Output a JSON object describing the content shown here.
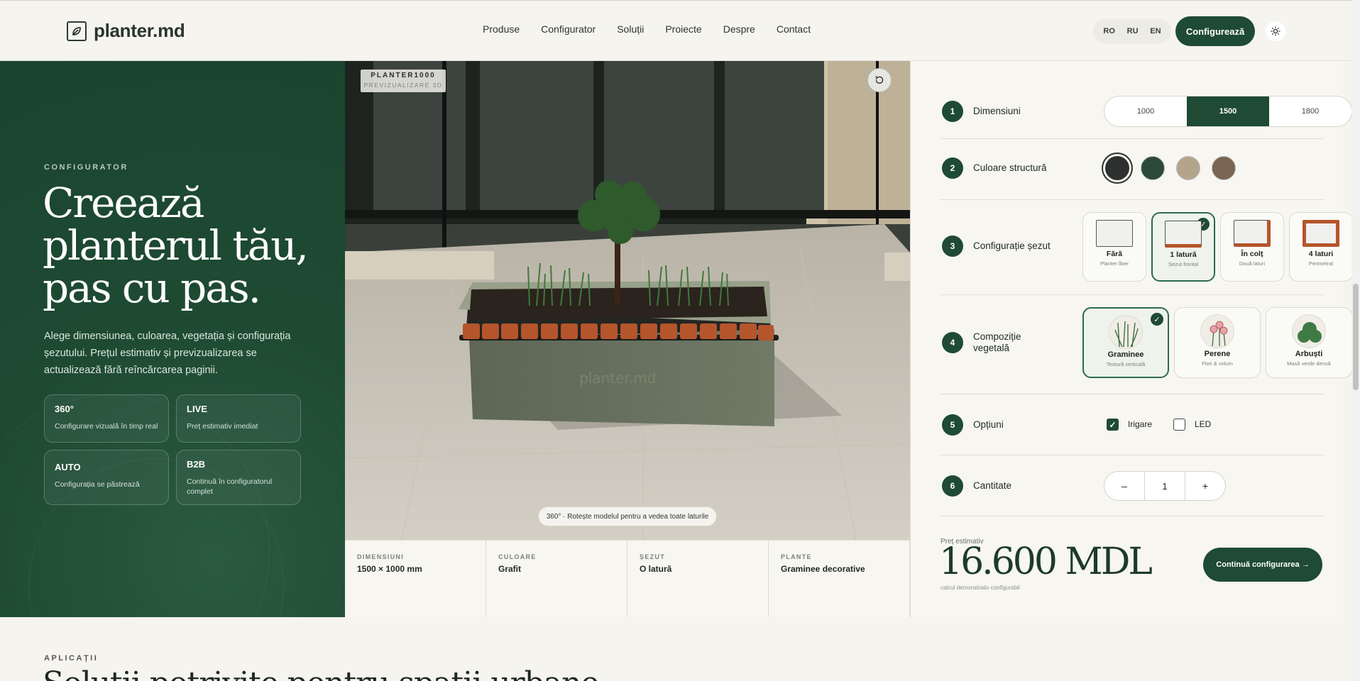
{
  "header": {
    "brand": "planter.md",
    "nav": [
      "Produse",
      "Configurator",
      "Soluții",
      "Proiecte",
      "Despre",
      "Contact"
    ],
    "langs": [
      "RO",
      "RU",
      "EN"
    ],
    "cta": "Configurează"
  },
  "hero": {
    "eyebrow": "CONFIGURATOR",
    "title": "Creează planterul tău, pas cu pas.",
    "lead": "Alege dimensiunea, culoarea, vegetația și configurația șezutului. Prețul estimativ și previzualizarea se actualizează fără reîncărcarea paginii.",
    "cards": [
      {
        "title": "360°",
        "desc": "Configurare vizuală în timp real"
      },
      {
        "title": "LIVE",
        "desc": "Preț estimativ imediat"
      },
      {
        "title": "AUTO",
        "desc": "Configurația se păstrează"
      },
      {
        "title": "B2B",
        "desc": "Continuă în configuratorul complet"
      }
    ]
  },
  "preview": {
    "badge_title": "PLANTER1000",
    "badge_sub": "PREVIZUALIZARE 3D",
    "engraving": "planter.md",
    "hint": "360° · Rotește modelul pentru a vedea toate laturile"
  },
  "summary": [
    {
      "key": "DIMENSIUNI",
      "value": "1500 × 1000 mm"
    },
    {
      "key": "CULOARE",
      "value": "Grafit"
    },
    {
      "key": "ȘEZUT",
      "value": "O latură"
    },
    {
      "key": "PLANTE",
      "value": "Graminee decorative"
    }
  ],
  "config": {
    "steps": [
      {
        "num": "1",
        "label": "Dimensiuni"
      },
      {
        "num": "2",
        "label": "Culoare structură"
      },
      {
        "num": "3",
        "label": "Configurație șezut"
      },
      {
        "num": "4",
        "label": "Compoziție vegetală"
      },
      {
        "num": "5",
        "label": "Opțiuni"
      },
      {
        "num": "6",
        "label": "Cantitate"
      }
    ],
    "dimensions": [
      "1000",
      "1500",
      "1800"
    ],
    "dimension_selected": "1500",
    "colors": [
      "#2d302e",
      "#2c4a3a",
      "#b5a48c",
      "#7a6452"
    ],
    "seating": [
      {
        "name": "Fără",
        "sub": "Planter liber"
      },
      {
        "name": "1 latură",
        "sub": "Șezut frontal"
      },
      {
        "name": "În colț",
        "sub": "Două laturi"
      },
      {
        "name": "4 laturi",
        "sub": "Perimetral"
      }
    ],
    "vegetation": [
      {
        "name": "Graminee",
        "sub": "Textură verticală"
      },
      {
        "name": "Perene",
        "sub": "Flori & volum"
      },
      {
        "name": "Arbuști",
        "sub": "Masă verde densă"
      }
    ],
    "options": [
      {
        "label": "Irigare",
        "checked": true
      },
      {
        "label": "LED",
        "checked": false
      }
    ],
    "quantity": "1",
    "minus": "–",
    "plus": "+",
    "check": "✓",
    "price_label": "Preț estimativ",
    "price": "16.600 MDL",
    "price_note": "calcul demonstrativ configurabil",
    "continue": "Continuă configurarea →"
  },
  "bottom": {
    "eyebrow": "APLICAȚII",
    "title": "Soluții potrivite pentru spații urbane"
  },
  "colors": {
    "brand": "#1f4a33",
    "accent_wood": "#b5552c"
  }
}
